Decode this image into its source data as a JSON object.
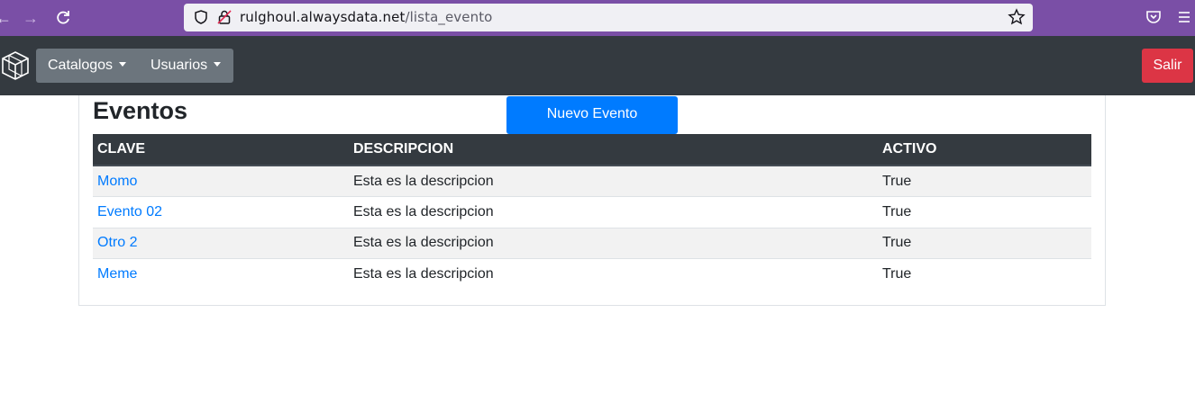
{
  "browser": {
    "url_host": "rulghoul.alwaysdata.net",
    "url_path": "/lista_evento"
  },
  "navbar": {
    "catalogos_label": "Catalogos",
    "usuarios_label": "Usuarios",
    "salir_label": "Salir"
  },
  "page": {
    "title": "Eventos",
    "new_button_label": "Nuevo Evento"
  },
  "table": {
    "headers": [
      "CLAVE",
      "DESCRIPCION",
      "ACTIVO"
    ],
    "rows": [
      {
        "clave": "Momo",
        "descripcion": "Esta es la descripcion",
        "activo": "True"
      },
      {
        "clave": "Evento 02",
        "descripcion": "Esta es la descripcion",
        "activo": "True"
      },
      {
        "clave": "Otro 2",
        "descripcion": "Esta es la descripcion",
        "activo": "True"
      },
      {
        "clave": "Meme",
        "descripcion": "Esta es la descripcion",
        "activo": "True"
      }
    ]
  },
  "colors": {
    "browser_accent": "#7a4fa6",
    "navbar_bg": "#343a40",
    "dropdown_bg": "#6c757d",
    "primary": "#007bff",
    "danger": "#dc3545"
  },
  "icons": {
    "back": "arrow-left-icon",
    "forward": "arrow-right-icon",
    "reload": "reload-icon",
    "shield": "shield-icon",
    "lock": "insecure-lock-icon",
    "bookmark": "star-icon",
    "pocket": "pocket-icon",
    "menu": "hamburger-menu-icon",
    "brand": "cube-logo-icon"
  }
}
